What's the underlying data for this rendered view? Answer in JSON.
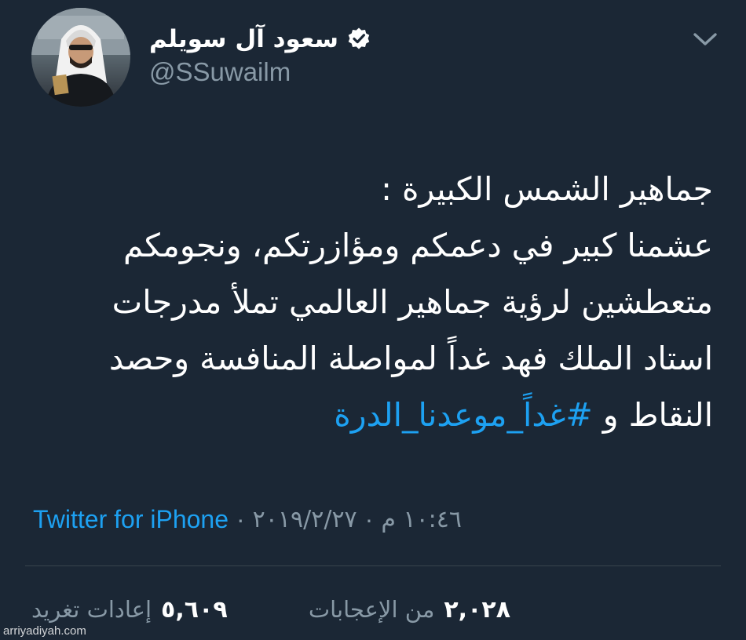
{
  "header": {
    "display_name": "سعود آل سويلم",
    "handle": "@SSuwailm"
  },
  "tweet": {
    "lines": [
      "جماهير الشمس الكبيرة :",
      "عشمنا كبير في دعمكم ومؤازرتكم، ونجومكم",
      "متعطشين لرؤية جماهير العالمي تملأ مدرجات",
      "استاد الملك فهد غداً لمواصلة المنافسة وحصد"
    ],
    "last_line_prefix": "النقاط و",
    "hashtag": "#غداً_موعدنا_الدرة"
  },
  "meta": {
    "time": "١٠:٤٦ م",
    "date": "٢٠١٩/٢/٢٧",
    "separator": "·",
    "source": "Twitter for iPhone"
  },
  "stats": {
    "likes_count": "٢,٠٢٨",
    "likes_label": "من الإعجابات",
    "retweets_count": "٥,٦٠٩",
    "retweets_label": "إعادات تغريد"
  },
  "watermark": "arriyadiyah.com",
  "colors": {
    "background": "#1b2735",
    "text": "#ffffff",
    "muted": "#8899a6",
    "link": "#1da1f2",
    "divider": "#38444d"
  },
  "icons": {
    "verified": "verified-badge-icon",
    "menu": "chevron-down-icon"
  }
}
